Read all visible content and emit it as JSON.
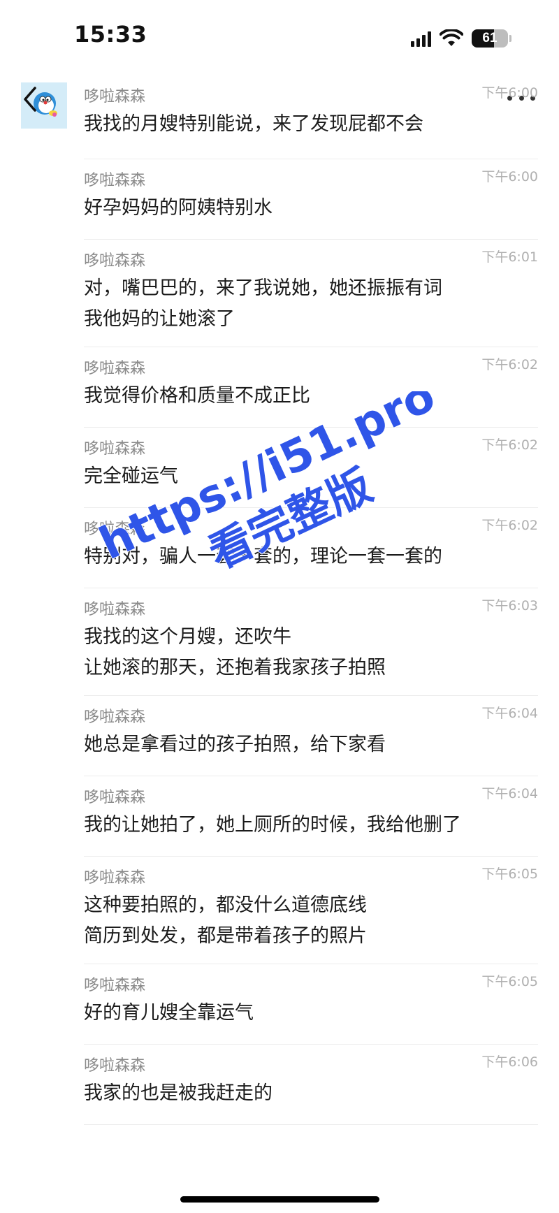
{
  "status_bar": {
    "time": "15:33",
    "battery": "61",
    "battery_level_pct": 61
  },
  "header": {
    "back_icon": "chevron-left-icon",
    "avatar_icon": "doraemon-avatar",
    "more_icon": "more-horizontal-icon"
  },
  "messages": [
    {
      "sender": "哆啦森森",
      "time": "下午6:00",
      "text": "我找的月嫂特别能说，来了发现屁都不会"
    },
    {
      "sender": "哆啦森森",
      "time": "下午6:00",
      "text": "好孕妈妈的阿姨特别水"
    },
    {
      "sender": "哆啦森森",
      "time": "下午6:01",
      "text": "对，嘴巴巴的，来了我说她，她还振振有词\n我他妈的让她滚了"
    },
    {
      "sender": "哆啦森森",
      "time": "下午6:02",
      "text": "我觉得价格和质量不成正比"
    },
    {
      "sender": "哆啦森森",
      "time": "下午6:02",
      "text": "完全碰运气"
    },
    {
      "sender": "哆啦森森",
      "time": "下午6:02",
      "text": "特别对，骗人一套一套的，理论一套一套的"
    },
    {
      "sender": "哆啦森森",
      "time": "下午6:03",
      "text": "我找的这个月嫂，还吹牛\n让她滚的那天，还抱着我家孩子拍照"
    },
    {
      "sender": "哆啦森森",
      "time": "下午6:04",
      "text": "她总是拿看过的孩子拍照，给下家看"
    },
    {
      "sender": "哆啦森森",
      "time": "下午6:04",
      "text": "我的让她拍了，她上厕所的时候，我给他删了"
    },
    {
      "sender": "哆啦森森",
      "time": "下午6:05",
      "text": "这种要拍照的，都没什么道德底线\n简历到处发，都是带着孩子的照片"
    },
    {
      "sender": "哆啦森森",
      "time": "下午6:05",
      "text": "好的育儿嫂全靠运气"
    },
    {
      "sender": "哆啦森森",
      "time": "下午6:06",
      "text": "我家的也是被我赶走的"
    }
  ],
  "watermark": {
    "line1": "https://i51.pro",
    "line2": "看完整版",
    "color": "#2f55e8"
  }
}
